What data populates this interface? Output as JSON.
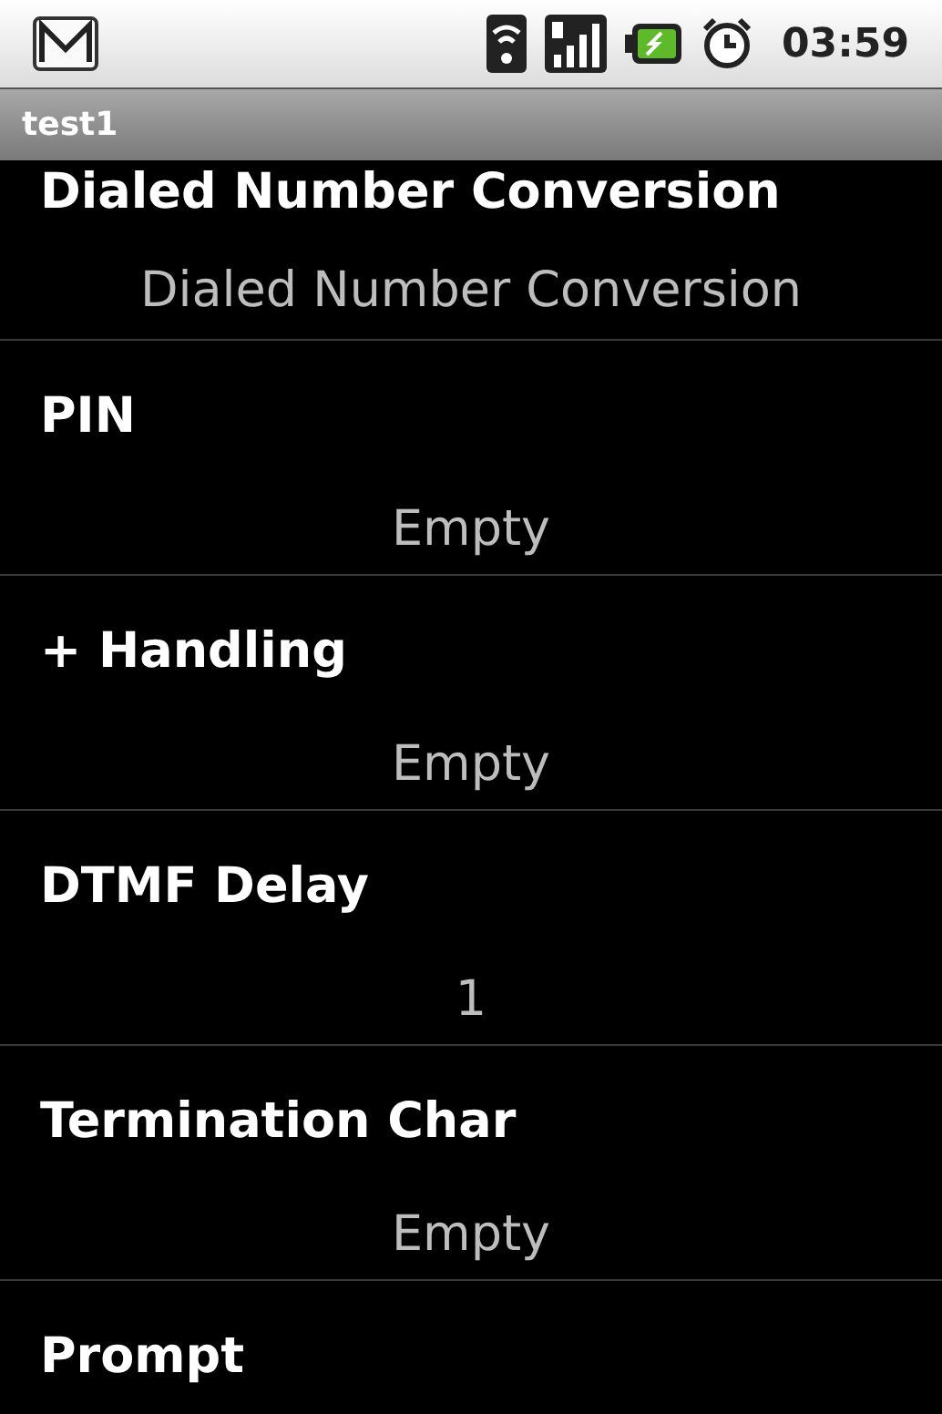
{
  "status_bar": {
    "time": "03:59"
  },
  "title_bar": {
    "title": "test1"
  },
  "preferences": [
    {
      "title": "Dialed Number Conversion",
      "summary": "Dialed Number Conversion"
    },
    {
      "title": "PIN",
      "summary": "Empty"
    },
    {
      "title": "+ Handling",
      "summary": "Empty"
    },
    {
      "title": "DTMF Delay",
      "summary": "1"
    },
    {
      "title": "Termination Char",
      "summary": "Empty"
    },
    {
      "title": "Prompt"
    }
  ]
}
